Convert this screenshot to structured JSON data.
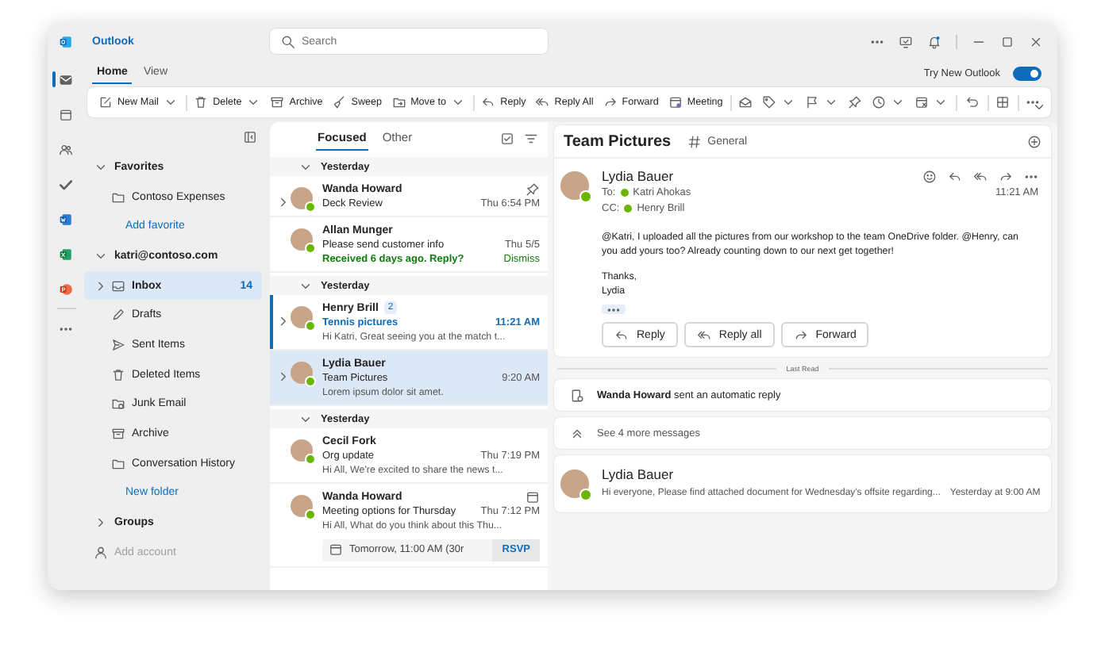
{
  "window": {
    "app_name": "Outlook"
  },
  "search": {
    "placeholder": "Search"
  },
  "rail": [
    {
      "kind": "mail",
      "selected": true
    },
    {
      "kind": "calendar",
      "selected": false
    },
    {
      "kind": "people",
      "selected": false
    },
    {
      "kind": "todo",
      "selected": false
    },
    {
      "kind": "document",
      "selected": false
    },
    {
      "kind": "spreadsheet",
      "selected": false
    },
    {
      "kind": "presentation",
      "selected": false
    },
    {
      "kind": "more",
      "selected": false
    }
  ],
  "ribbon_tabs": [
    {
      "label": "Home",
      "selected": true
    },
    {
      "label": "View",
      "selected": false
    }
  ],
  "try_new_outlook": {
    "label": "Try New Outlook",
    "on": true
  },
  "ribbon": [
    {
      "kind": "compose",
      "label": "New Mail",
      "dropdown": true
    },
    {
      "kind": "separator"
    },
    {
      "kind": "trash",
      "label": "Delete",
      "dropdown": true
    },
    {
      "kind": "archive",
      "label": "Archive",
      "dropdown": false
    },
    {
      "kind": "broom",
      "label": "Sweep",
      "dropdown": false
    },
    {
      "kind": "move",
      "label": "Move to",
      "dropdown": true
    },
    {
      "kind": "separator"
    },
    {
      "kind": "reply",
      "label": "Reply",
      "dropdown": false
    },
    {
      "kind": "reply_all",
      "label": "Reply All",
      "dropdown": false
    },
    {
      "kind": "forward",
      "label": "Forward",
      "dropdown": false
    },
    {
      "kind": "meeting",
      "label": "Meeting",
      "dropdown": false
    },
    {
      "kind": "separator"
    },
    {
      "kind": "read",
      "dropdown": false
    },
    {
      "kind": "tag",
      "dropdown": true
    },
    {
      "kind": "flag",
      "dropdown": true
    },
    {
      "kind": "pin",
      "dropdown": false
    },
    {
      "kind": "snooze",
      "dropdown": true
    },
    {
      "kind": "rules",
      "dropdown": true
    },
    {
      "kind": "separator"
    },
    {
      "kind": "undo",
      "dropdown": false
    },
    {
      "kind": "separator"
    },
    {
      "kind": "apps",
      "dropdown": false
    },
    {
      "kind": "separator"
    },
    {
      "kind": "more",
      "dropdown": false
    }
  ],
  "folder_pane": {
    "sections": [
      {
        "label": "Favorites",
        "expanded": true,
        "items": [
          {
            "kind": "folder",
            "label": "Contoso Expenses",
            "selected": false,
            "expandable": false
          }
        ],
        "link": "Add favorite"
      },
      {
        "label": "katri@contoso.com",
        "expanded": true,
        "items": [
          {
            "kind": "inbox",
            "label": "Inbox",
            "count": "14",
            "selected": true,
            "expandable": true
          },
          {
            "kind": "drafts",
            "label": "Drafts",
            "selected": false,
            "expandable": false
          },
          {
            "kind": "sent",
            "label": "Sent Items",
            "selected": false,
            "expandable": false
          },
          {
            "kind": "deleted",
            "label": "Deleted Items",
            "selected": false,
            "expandable": false
          },
          {
            "kind": "junk",
            "label": "Junk Email",
            "selected": false,
            "expandable": false
          },
          {
            "kind": "archive",
            "label": "Archive",
            "selected": false,
            "expandable": false
          },
          {
            "kind": "folder",
            "label": "Conversation History",
            "selected": false,
            "expandable": false
          }
        ],
        "link": "New folder"
      },
      {
        "label": "Groups",
        "expanded": false
      }
    ],
    "add_account": {
      "label": "Add account",
      "disabled": true
    }
  },
  "message_list": {
    "tabs": [
      {
        "label": "Focused",
        "selected": true
      },
      {
        "label": "Other",
        "selected": false
      }
    ],
    "groups": [
      {
        "label": "Yesterday",
        "expanded": true,
        "messages": [
          {
            "sender": "Wanda Howard",
            "subject": "Deck Review",
            "time": "Thu 6:54 PM",
            "online": true,
            "thread": true,
            "pinned": true,
            "unread": false,
            "selected": false
          },
          {
            "sender": "Allan Munger",
            "subject": "Please send customer info",
            "time": "Thu 5/5",
            "online": true,
            "thread": false,
            "pinned": false,
            "unread": false,
            "selected": false,
            "reminder": {
              "text": "Received 6 days ago. Reply?",
              "action": "Dismiss"
            }
          }
        ]
      },
      {
        "label": "Yesterday",
        "expanded": true,
        "messages": [
          {
            "sender": "Henry Brill",
            "count": "2",
            "subject": "Tennis pictures",
            "time": "11:21 AM",
            "preview": "Hi Katri, Great seeing you at the match t...",
            "online": true,
            "thread": true,
            "pinned": false,
            "unread": true,
            "selected": false
          },
          {
            "sender": "Lydia Bauer",
            "subject": "Team Pictures",
            "time": "9:20 AM",
            "preview": "Lorem ipsum dolor sit amet.",
            "online": true,
            "thread": true,
            "pinned": false,
            "unread": false,
            "selected": true
          }
        ]
      },
      {
        "label": "Yesterday",
        "expanded": true,
        "messages": [
          {
            "sender": "Cecil Fork",
            "subject": "Org update",
            "time": "Thu 7:19 PM",
            "preview": "Hi All, We're excited to share the news t...",
            "online": true,
            "thread": false,
            "pinned": false,
            "unread": false,
            "selected": false
          },
          {
            "sender": "Wanda Howard",
            "subject": "Meeting options for Thursday",
            "time": "Thu 7:12 PM",
            "preview": "Hi All, What do you think about this Thu...",
            "online": true,
            "thread": false,
            "pinned": false,
            "unread": false,
            "selected": false,
            "meeting": {
              "text": "Tomorrow, 11:00 AM (30r",
              "action": "RSVP"
            }
          }
        ]
      }
    ]
  },
  "reading_pane": {
    "title": "Team Pictures",
    "channel": "General",
    "message": {
      "sender": "Lydia Bauer",
      "online": true,
      "to_label": "To:",
      "to": [
        {
          "name": "Katri Ahokas",
          "online": true
        }
      ],
      "cc_label": "CC:",
      "cc": [
        {
          "name": "Henry Brill",
          "online": true
        }
      ],
      "time": "11:21 AM",
      "body": "@Katri, I uploaded all the pictures from our workshop to the team OneDrive folder. @Henry, can you add yours too? Already counting down to our next get together!",
      "signoff": [
        "Thanks,",
        "Lydia"
      ],
      "actions": [
        {
          "kind": "reply",
          "label": "Reply"
        },
        {
          "kind": "reply_all",
          "label": "Reply all"
        },
        {
          "kind": "forward",
          "label": "Forward"
        }
      ]
    },
    "divider": "Last Read",
    "auto_reply": "**Wanda Howard** sent an automatic reply",
    "see_more": "See 4 more messages",
    "collapsed": [
      {
        "sender": "Lydia Bauer",
        "online": true,
        "preview": "Hi everyone, Please find attached document for Wednesday's offsite regarding...",
        "time": "Yesterday at 9:00 AM"
      }
    ]
  }
}
